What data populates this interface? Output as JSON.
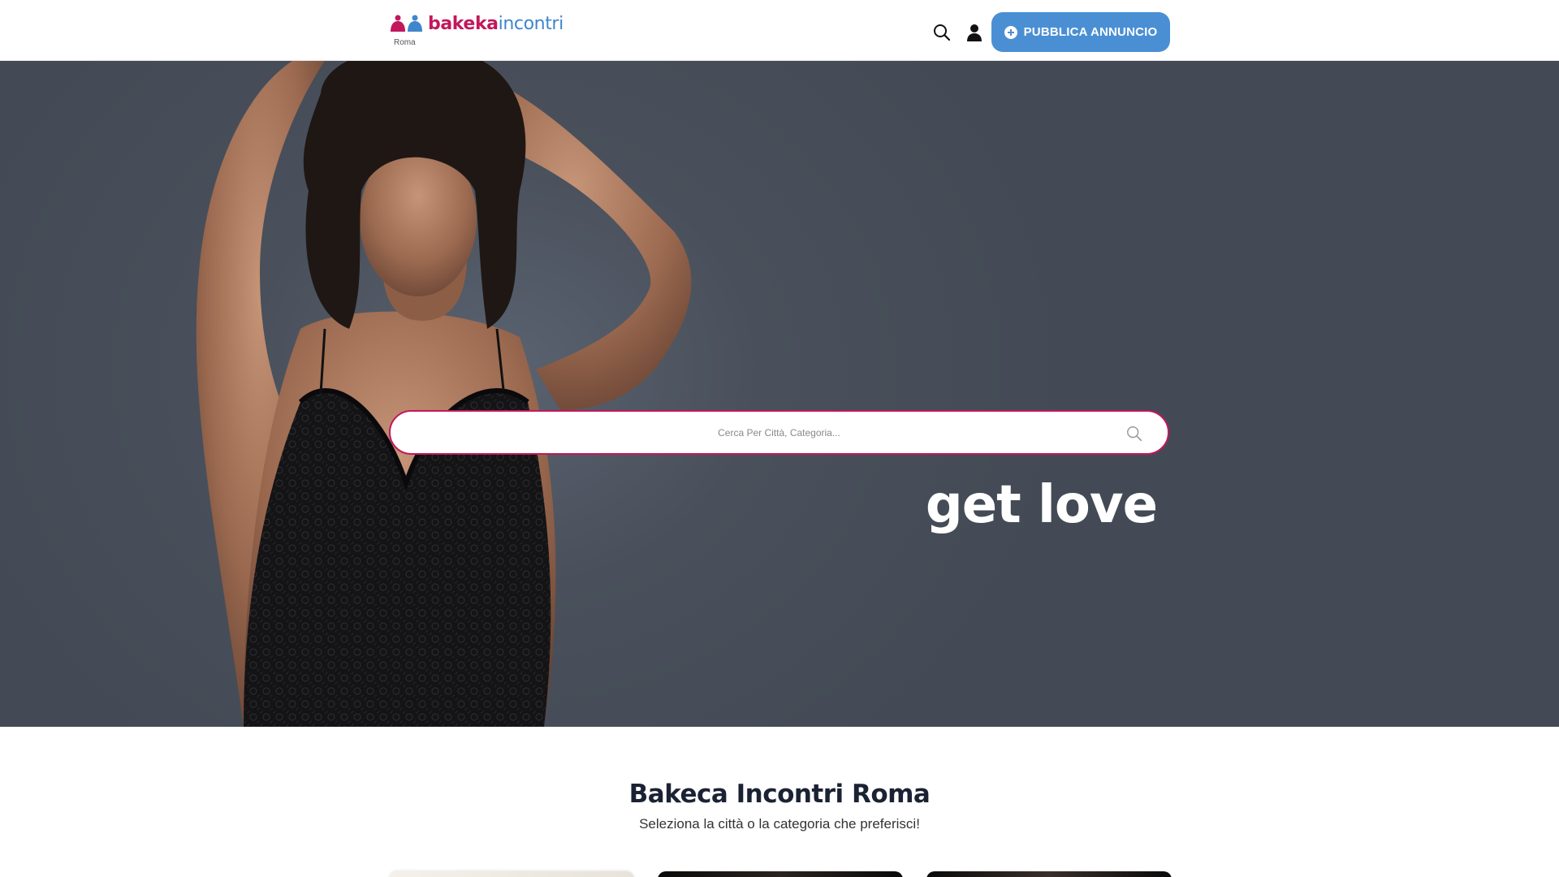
{
  "header": {
    "logo_text_pink": "bakeka",
    "logo_text_blue": "incontri",
    "city": "Roma",
    "search_icon": "search-icon",
    "user_icon": "user-icon",
    "publish_label": "PUBBLICA ANNUNCIO",
    "publish_icon": "plus-circle-icon"
  },
  "hero": {
    "search_placeholder": "Cerca Per Città, Categoria...",
    "slogan": "get love"
  },
  "section": {
    "title": "Bakeca Incontri Roma",
    "subtitle": "Seleziona la città o la categoria che preferisci!"
  },
  "colors": {
    "brand_pink": "#c2185b",
    "brand_blue": "#4a8fd4",
    "hero_bg": "#49505b",
    "title_dark": "#1b2233"
  }
}
